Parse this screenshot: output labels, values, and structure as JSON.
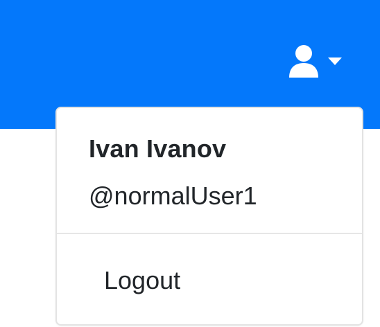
{
  "navbar": {
    "background_color": "#0478fb",
    "user_menu": {
      "icon": "user-icon",
      "caret_icon": "caret-down-icon",
      "icon_color": "#ffffff"
    }
  },
  "dropdown": {
    "user_name": "Ivan Ivanov",
    "user_handle": "@normalUser1",
    "items": [
      {
        "label": "Logout"
      }
    ]
  }
}
